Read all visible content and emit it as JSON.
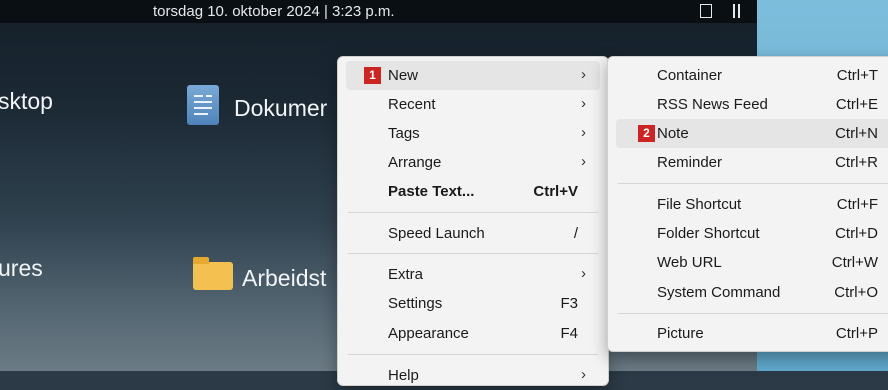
{
  "topbar": {
    "datetime": "torsdag 10. oktober 2024 | 3:23 p.m."
  },
  "desktop": {
    "labels": [
      "sktop",
      "Dokumer",
      "ures",
      "Arbeidst"
    ]
  },
  "main_menu": {
    "items": [
      {
        "label": "New",
        "badge": "1",
        "submenu": true
      },
      {
        "label": "Recent",
        "submenu": true
      },
      {
        "label": "Tags",
        "submenu": true
      },
      {
        "label": "Arrange",
        "submenu": true
      },
      {
        "label": "Paste Text...",
        "shortcut": "Ctrl+V",
        "bold": true
      },
      {
        "label": "Speed Launch",
        "shortcut": "/"
      },
      {
        "label": "Extra",
        "submenu": true
      },
      {
        "label": "Settings",
        "shortcut": "F3"
      },
      {
        "label": "Appearance",
        "shortcut": "F4"
      },
      {
        "label": "Help",
        "submenu": true
      }
    ]
  },
  "sub_menu": {
    "items": [
      {
        "label": "Container",
        "shortcut": "Ctrl+T"
      },
      {
        "label": "RSS News Feed",
        "shortcut": "Ctrl+E"
      },
      {
        "label": "Note",
        "shortcut": "Ctrl+N",
        "badge": "2"
      },
      {
        "label": "Reminder",
        "shortcut": "Ctrl+R"
      },
      {
        "label": "File Shortcut",
        "shortcut": "Ctrl+F"
      },
      {
        "label": "Folder Shortcut",
        "shortcut": "Ctrl+D"
      },
      {
        "label": "Web URL",
        "shortcut": "Ctrl+W"
      },
      {
        "label": "System Command",
        "shortcut": "Ctrl+O"
      },
      {
        "label": "Picture",
        "shortcut": "Ctrl+P"
      }
    ]
  },
  "icons": {
    "submenu_arrow": "chevron-right-icon",
    "document": "document-icon",
    "folder": "folder-icon"
  },
  "colors": {
    "badge": "#cc2323",
    "highlight": "#e5e5e5",
    "menu_bg": "#f3f3f3"
  }
}
